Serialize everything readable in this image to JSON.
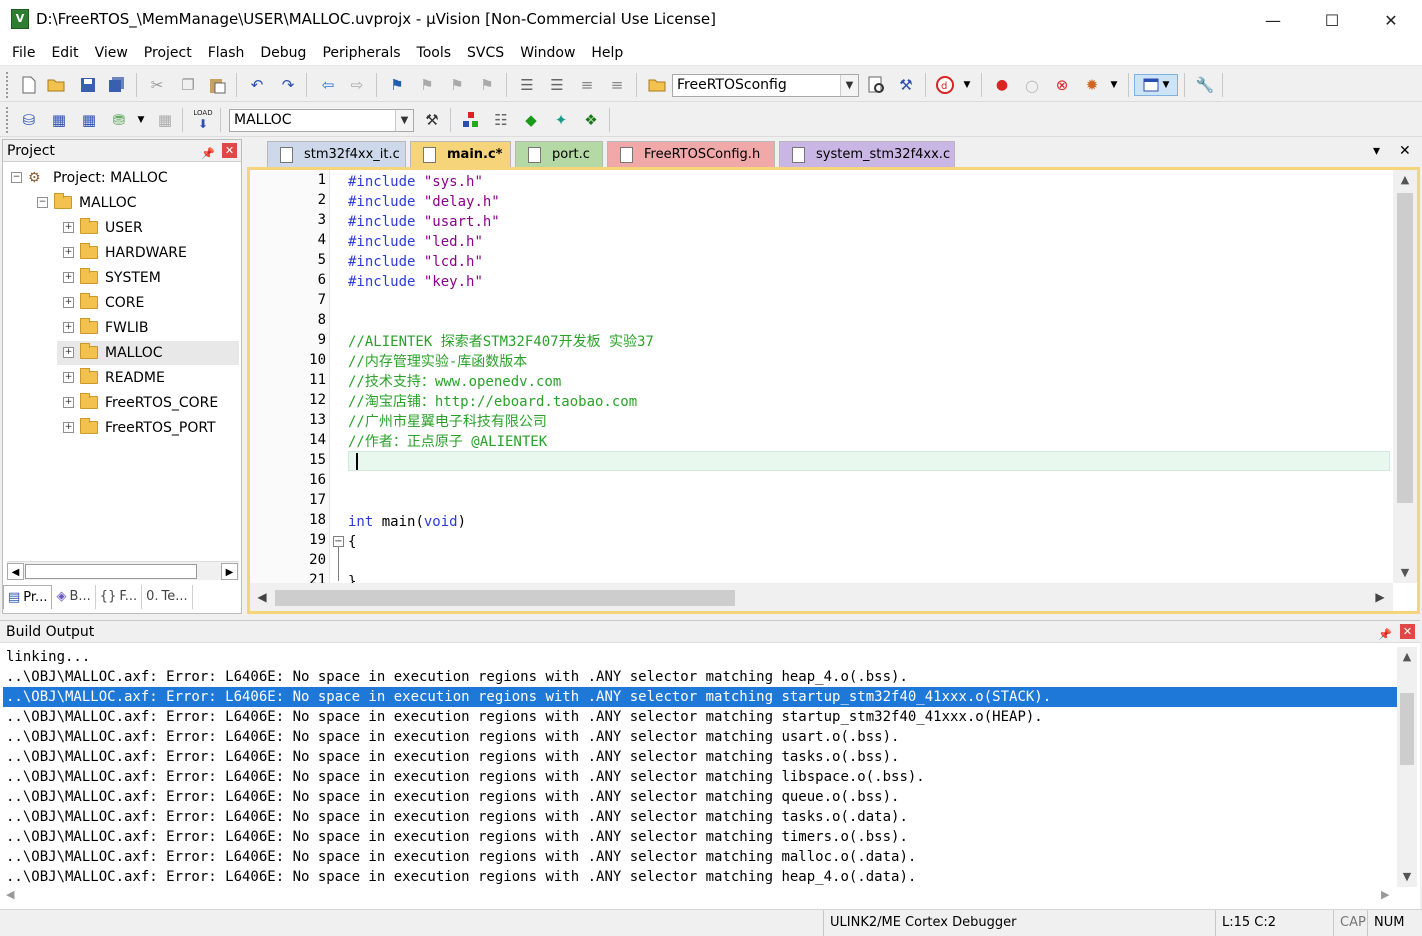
{
  "window": {
    "title": "D:\\FreeRTOS_\\MemManage\\USER\\MALLOC.uvprojx - µVision  [Non-Commercial Use License]",
    "app_icon_text": "V",
    "controls": {
      "minimize": "—",
      "maximize": "☐",
      "close": "✕"
    }
  },
  "menu": [
    "File",
    "Edit",
    "View",
    "Project",
    "Flash",
    "Debug",
    "Peripherals",
    "Tools",
    "SVCS",
    "Window",
    "Help"
  ],
  "toolbar1": {
    "config_name": "FreeRTOSconfig",
    "icons": [
      "new-file-icon",
      "open-file-icon",
      "save-icon",
      "save-all-icon",
      "cut-icon",
      "copy-icon",
      "paste-icon",
      "undo-icon",
      "redo-icon",
      "nav-back-icon",
      "nav-forward-icon",
      "bookmark-icon",
      "bookmark-prev-icon",
      "bookmark-next-icon",
      "bookmark-clear-icon",
      "indent-icon",
      "unindent-icon",
      "comment-icon",
      "uncomment-icon",
      "find-in-files-icon",
      "find-icon",
      "debug-session-icon",
      "breakpoint-icon",
      "breakpoint-disable-icon",
      "breakpoint-kill-icon",
      "breakpoint-manage-icon",
      "window-layout-icon",
      "config-wrench-icon"
    ]
  },
  "toolbar2": {
    "target_name": "MALLOC",
    "load_label": "LOAD",
    "icons": [
      "compile-icon",
      "build-icon",
      "rebuild-icon",
      "batch-build-icon",
      "stop-build-icon",
      "download-icon",
      "target-options-icon",
      "manage-components-icon",
      "pack-installer-icon",
      "select-device-icon",
      "run-time-env-icon",
      "software-packs-icon"
    ]
  },
  "project_panel": {
    "title": "Project",
    "root": "Project: MALLOC",
    "target": "MALLOC",
    "groups": [
      "USER",
      "HARDWARE",
      "SYSTEM",
      "CORE",
      "FWLIB",
      "MALLOC",
      "README",
      "FreeRTOS_CORE",
      "FreeRTOS_PORT"
    ],
    "selected_group": "MALLOC",
    "tabs": [
      "Pr...",
      "B...",
      "F...",
      "Te..."
    ]
  },
  "editor": {
    "tabs": [
      {
        "label": "stm32f4xx_it.c",
        "color": "#cdd9ea"
      },
      {
        "label": "main.c*",
        "color": "#f5d47a",
        "active": true
      },
      {
        "label": "port.c",
        "color": "#b5d9a5"
      },
      {
        "label": "FreeRTOSConfig.h",
        "color": "#f0a8a8"
      },
      {
        "label": "system_stm32f4xx.c",
        "color": "#c9b6e4"
      }
    ],
    "tab_dropdown": "▾",
    "tab_close": "✕",
    "cursor_line": 15,
    "line_numbers": [
      "1",
      "2",
      "3",
      "4",
      "5",
      "6",
      "7",
      "8",
      "9",
      "10",
      "11",
      "12",
      "13",
      "14",
      "15",
      "16",
      "17",
      "18",
      "19",
      "20",
      "21"
    ],
    "lines": [
      "#include \"sys.h\"",
      "#include \"delay.h\"",
      "#include \"usart.h\"",
      "#include \"led.h\"",
      "#include \"lcd.h\"",
      "#include \"key.h\"",
      "",
      "",
      "//ALIENTEK 探索者STM32F407开发板 实验37",
      "//内存管理实验-库函数版本",
      "//技术支持：www.openedv.com",
      "//淘宝店铺：http://eboard.taobao.com",
      "//广州市星翼电子科技有限公司",
      "//作者：正点原子 @ALIENTEK",
      "",
      "",
      "",
      "int main(void)",
      "{",
      "",
      "}"
    ]
  },
  "build_output": {
    "title": "Build Output",
    "selected_index": 2,
    "lines": [
      "linking...",
      "..\\OBJ\\MALLOC.axf: Error: L6406E: No space in execution regions with .ANY selector matching heap_4.o(.bss).",
      "..\\OBJ\\MALLOC.axf: Error: L6406E: No space in execution regions with .ANY selector matching startup_stm32f40_41xxx.o(STACK).",
      "..\\OBJ\\MALLOC.axf: Error: L6406E: No space in execution regions with .ANY selector matching startup_stm32f40_41xxx.o(HEAP).",
      "..\\OBJ\\MALLOC.axf: Error: L6406E: No space in execution regions with .ANY selector matching usart.o(.bss).",
      "..\\OBJ\\MALLOC.axf: Error: L6406E: No space in execution regions with .ANY selector matching tasks.o(.bss).",
      "..\\OBJ\\MALLOC.axf: Error: L6406E: No space in execution regions with .ANY selector matching libspace.o(.bss).",
      "..\\OBJ\\MALLOC.axf: Error: L6406E: No space in execution regions with .ANY selector matching queue.o(.bss).",
      "..\\OBJ\\MALLOC.axf: Error: L6406E: No space in execution regions with .ANY selector matching tasks.o(.data).",
      "..\\OBJ\\MALLOC.axf: Error: L6406E: No space in execution regions with .ANY selector matching timers.o(.bss).",
      "..\\OBJ\\MALLOC.axf: Error: L6406E: No space in execution regions with .ANY selector matching malloc.o(.data).",
      "..\\OBJ\\MALLOC.axf: Error: L6406E: No space in execution regions with .ANY selector matching heap_4.o(.data)."
    ]
  },
  "status_bar": {
    "debugger": "ULINK2/ME Cortex Debugger",
    "position": "L:15 C:2",
    "cap": "CAP",
    "num": "NUM"
  },
  "colors": {
    "editor_border": "#f5d47a",
    "selection": "#1e78d7",
    "comment": "#2aa22a",
    "keyword": "#2d3bd6",
    "string": "#8b008b"
  }
}
